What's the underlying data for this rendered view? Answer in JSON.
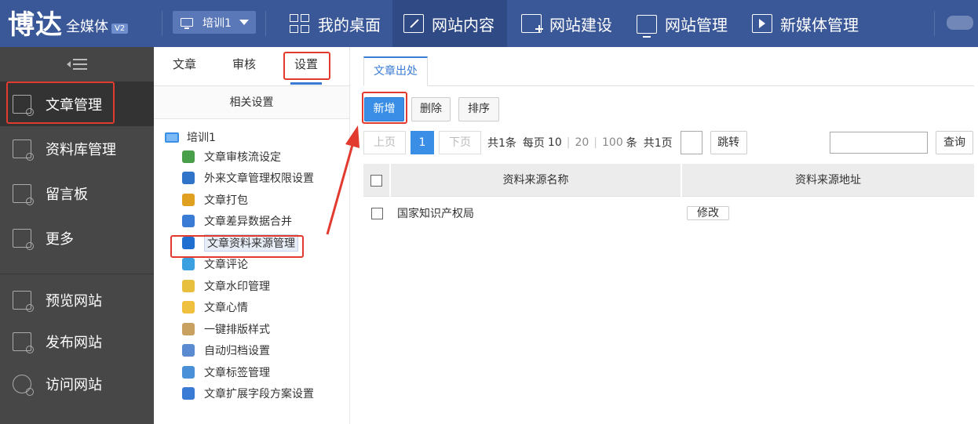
{
  "brand": {
    "main": "博达",
    "sub": "全媒体",
    "version": "V2"
  },
  "site_selector": {
    "value": "培训1"
  },
  "topnav": [
    {
      "label": "我的桌面"
    },
    {
      "label": "网站内容"
    },
    {
      "label": "网站建设"
    },
    {
      "label": "网站管理"
    },
    {
      "label": "新媒体管理"
    }
  ],
  "sidebar": {
    "items": [
      {
        "label": "文章管理"
      },
      {
        "label": "资料库管理"
      },
      {
        "label": "留言板"
      },
      {
        "label": "更多"
      },
      {
        "label": "预览网站"
      },
      {
        "label": "发布网站"
      },
      {
        "label": "访问网站"
      }
    ]
  },
  "mid": {
    "tabs": [
      {
        "label": "文章"
      },
      {
        "label": "审核"
      },
      {
        "label": "设置"
      }
    ],
    "header": "相关设置",
    "tree_root": "培训1",
    "tree_items": [
      {
        "label": "文章审核流设定",
        "icon": "users-icon"
      },
      {
        "label": "外来文章管理权限设置",
        "icon": "user-icon"
      },
      {
        "label": "文章打包",
        "icon": "package-icon"
      },
      {
        "label": "文章差异数据合并",
        "icon": "merge-icon"
      },
      {
        "label": "文章资料来源管理",
        "icon": "source-icon"
      },
      {
        "label": "文章评论",
        "icon": "keyboard-icon"
      },
      {
        "label": "文章水印管理",
        "icon": "watermark-icon"
      },
      {
        "label": "文章心情",
        "icon": "emoji-icon"
      },
      {
        "label": "一键排版样式",
        "icon": "format-icon"
      },
      {
        "label": "自动归档设置",
        "icon": "archive-icon"
      },
      {
        "label": "文章标签管理",
        "icon": "tag-icon"
      },
      {
        "label": "文章扩展字段方案设置",
        "icon": "extend-icon"
      }
    ]
  },
  "content": {
    "tab": "文章出处",
    "toolbar": {
      "add": "新增",
      "delete": "删除",
      "sort": "排序"
    },
    "pager": {
      "prev": "上页",
      "current": "1",
      "next": "下页",
      "total": "共1条",
      "per_page_label": "每页",
      "size_10": "10",
      "size_20": "20",
      "size_100": "100",
      "unit": "条",
      "pages": "共1页",
      "jump": "跳转"
    },
    "search_button": "查询",
    "table": {
      "columns": [
        "资料来源名称",
        "资料来源地址"
      ],
      "rows": [
        {
          "name": "国家知识产权局",
          "action": "修改"
        }
      ]
    }
  },
  "colors": {
    "topbar": "#3a5797",
    "sidebar": "#474747",
    "accent": "#3a8ee6",
    "highlight": "#e23a2f"
  }
}
